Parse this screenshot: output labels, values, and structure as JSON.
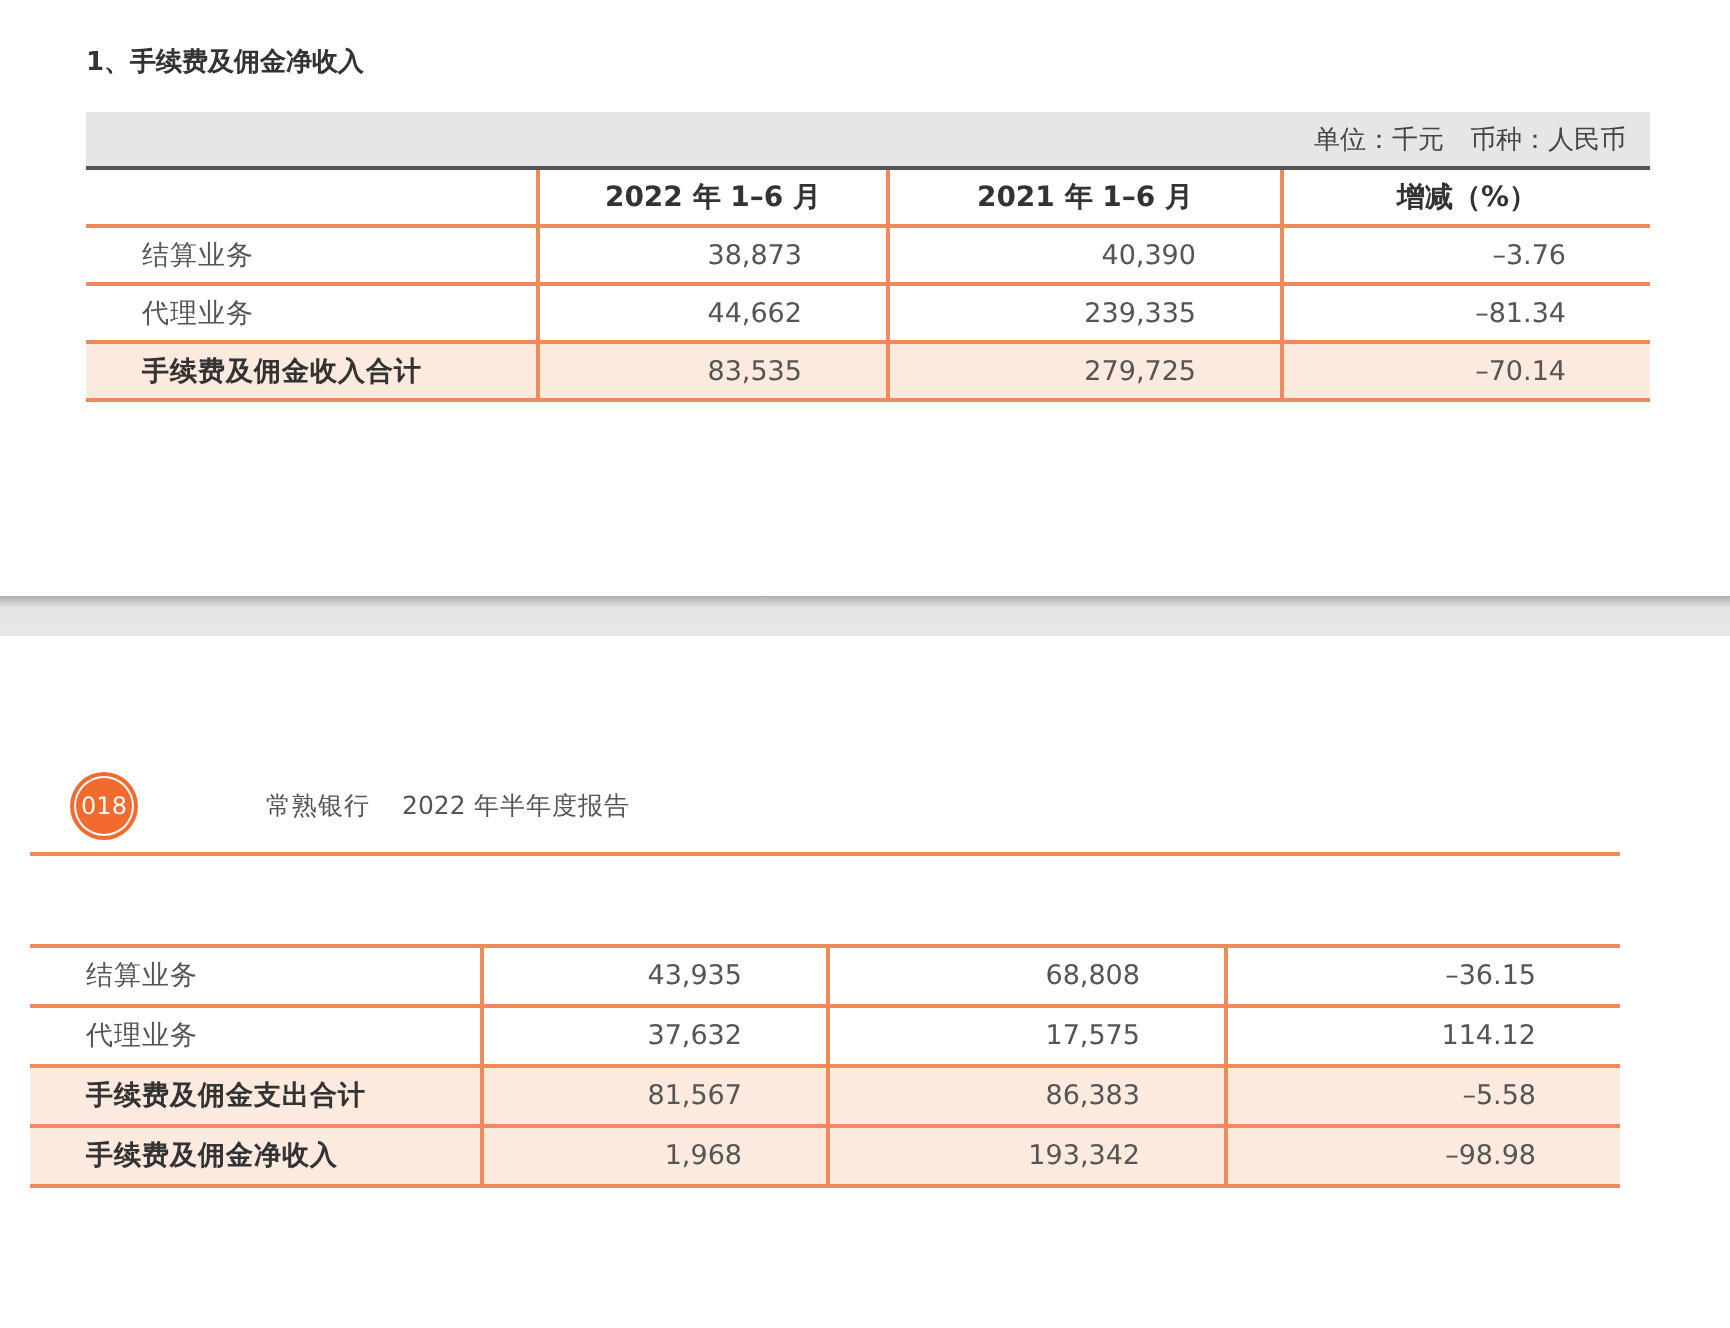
{
  "page_1": {
    "heading": "1、手续费及佣金净收入",
    "table": {
      "unit_note": "单位：千元　币种：人民币",
      "columns": [
        "",
        "2022 年 1–6 月",
        "2021 年 1–6 月",
        "增减（%）"
      ],
      "rows": [
        {
          "kind": "item",
          "cells": [
            "结算业务",
            "38,873",
            "40,390",
            "–3.76"
          ]
        },
        {
          "kind": "item",
          "cells": [
            "代理业务",
            "44,662",
            "239,335",
            "–81.34"
          ]
        },
        {
          "kind": "total",
          "cells": [
            "手续费及佣金收入合计",
            "83,535",
            "279,725",
            "–70.14"
          ]
        }
      ]
    }
  },
  "page_2": {
    "page_number": "018",
    "running_header": [
      "常熟银行",
      "2022 年半年度报告"
    ],
    "table": {
      "rows": [
        {
          "kind": "item",
          "cells": [
            "结算业务",
            "43,935",
            "68,808",
            "–36.15"
          ]
        },
        {
          "kind": "item",
          "cells": [
            "代理业务",
            "37,632",
            "17,575",
            "114.12"
          ]
        },
        {
          "kind": "total",
          "cells": [
            "手续费及佣金支出合计",
            "81,567",
            "86,383",
            "–5.58"
          ]
        },
        {
          "kind": "total",
          "cells": [
            "手续费及佣金净收入",
            "1,968",
            "193,342",
            "–98.98"
          ]
        }
      ]
    }
  }
}
